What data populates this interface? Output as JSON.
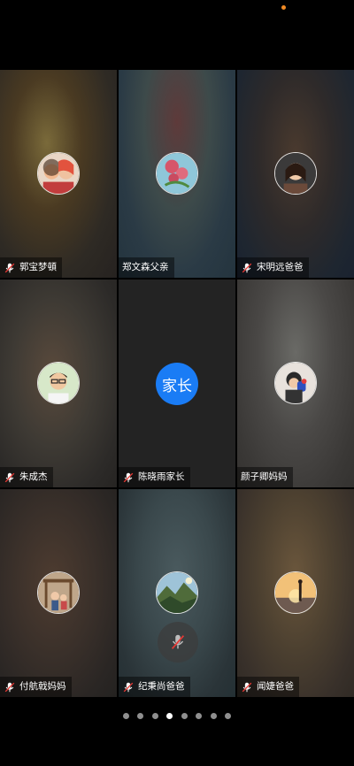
{
  "colors": {
    "background": "#000000",
    "status_dot": "#f08a24",
    "text_avatar_bg": "#1a7cf5",
    "pager_active": "#ffffff",
    "pager_inactive": "#8f8f8f"
  },
  "participants": [
    {
      "name": "郭宝梦頓",
      "muted": true,
      "avatar": "photo-avatar-girls"
    },
    {
      "name": "郑文森父亲",
      "muted": false,
      "avatar": "photo-avatar-flowers"
    },
    {
      "name": "宋明远爸爸",
      "muted": true,
      "avatar": "photo-avatar-girl-portrait"
    },
    {
      "name": "朱成杰",
      "muted": true,
      "avatar": "photo-avatar-boy-glasses"
    },
    {
      "name": "陈晓雨家长",
      "muted": true,
      "avatar_text": "家长"
    },
    {
      "name": "颜子卿妈妈",
      "muted": false,
      "avatar": "photo-avatar-child-toy"
    },
    {
      "name": "付航戟妈妈",
      "muted": true,
      "avatar": "photo-avatar-kids-playground"
    },
    {
      "name": "纪秉尚爸爸",
      "muted": true,
      "avatar": "photo-avatar-mountains"
    },
    {
      "name": "闻婕爸爸",
      "muted": true,
      "avatar": "photo-avatar-sunset"
    }
  ],
  "overlay": {
    "icon": "mic-off-icon"
  },
  "pager": {
    "count": 8,
    "active_index": 3
  }
}
